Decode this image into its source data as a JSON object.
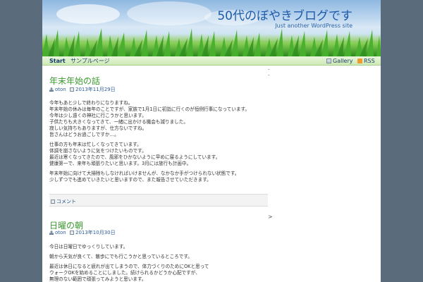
{
  "header": {
    "title": "50代のぼやきブログです",
    "description": "Just another WordPress site"
  },
  "nav": {
    "start": "Start",
    "page": "サンプルページ",
    "gallery": "Gallery",
    "rss": "RSS"
  },
  "sidebar": {
    "marker1": "-",
    "marker2": "-"
  },
  "posts": [
    {
      "title": "年末年始の話",
      "author": "oton",
      "date": "2013年11月29日",
      "paragraphs": [
        [
          "今年もあと少しで終わりになりますね。"
        ],
        [
          "年末年始の休みは毎年のことですが、家族で1月1日に初詣に行くのが恒例行事になっています。",
          "今年は少し遠くの神社に行こうかと思います。",
          "子供たちも大きくなってきて、一緒に出かける機会も減りました。",
          "寂しい気持ちもありますが、仕方ないですね。",
          "皆さんはどうお過ごしですか…。"
        ],
        [
          "仕事の方も年末は忙しくなってきています。",
          "体調を崩さないように気をつけたいものです。",
          "最近は寒くなってきたので、風邪をひかないように早めに寝るようにしています。",
          "健康第一で、来年も頑張りたいと思います。3月には旅行も計画中。"
        ],
        [
          "年末年始に向けて大掃除もしなければいけませんが、なかなか手がつけられない状態です。",
          "少しずつでも進めていきたいと思いますので、また報告させていただきます。"
        ]
      ],
      "footer_link": "コメント"
    },
    {
      "title": "日曜の朝",
      "author": "oton",
      "date": "2013年10月30日",
      "paragraphs": [
        [
          "今日は日曜日でゆっくりしています。"
        ],
        [
          "朝から天気が良くて、散歩にでも行こうかと思っているところです。"
        ],
        [
          "最近は休日になると疲れが出てしまうので、体力づくりのためにOKと思って",
          "ウォークOKを始めることにしました。続けられるかどうか心配ですが、",
          "無理のない範囲で頑張ってみようと思います。"
        ]
      ]
    }
  ],
  "pager": ">",
  "colors": {
    "title_blue": "#1d5aa8",
    "post_title_green": "#3b9a2e",
    "side_background": "#5a6b7c"
  }
}
